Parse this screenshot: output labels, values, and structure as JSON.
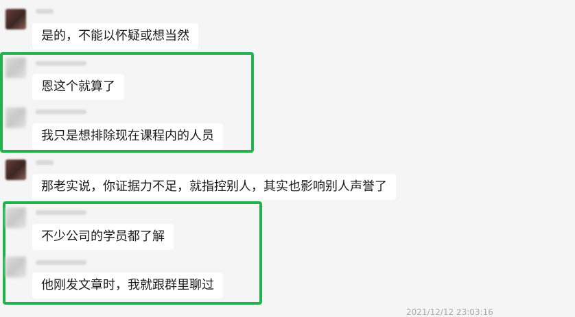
{
  "messages": [
    {
      "text": "是的，不能以怀疑或想当然"
    },
    {
      "text": "恩这个就算了"
    },
    {
      "text": "我只是想排除现在课程内的人员"
    },
    {
      "text": "那老实说，你证据力不足，就指控别人，其实也影响别人声誉了"
    },
    {
      "text": "不少公司的学员都了解"
    },
    {
      "text": "他刚发文章时，我就跟群里聊过"
    }
  ],
  "timestamp": "2021/12/12 23:03:16",
  "colors": {
    "highlight": "#23b14d",
    "background": "#f5f5f5",
    "bubble": "#ffffff"
  }
}
